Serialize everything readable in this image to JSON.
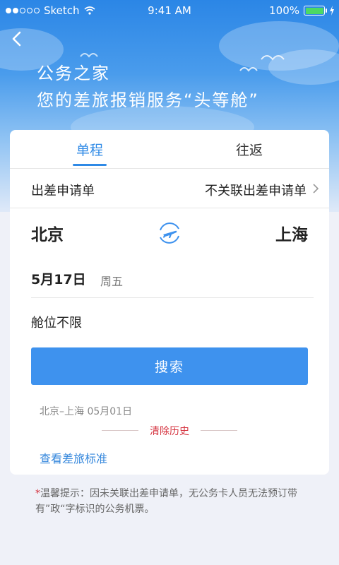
{
  "status_bar": {
    "carrier": "Sketch",
    "time": "9:41 AM",
    "battery": "100%",
    "battery_level": 1.0,
    "battery_color": "#4cd964"
  },
  "header": {
    "back_icon": "chevron-left-icon",
    "title": "公务之家",
    "subtitle": "您的差旅报销服务“头等舱”"
  },
  "tabs": [
    {
      "label": "单程",
      "active": true
    },
    {
      "label": "往返",
      "active": false
    }
  ],
  "application_row": {
    "label": "出差申请单",
    "value": "不关联出差申请单",
    "icon": "chevron-right-icon"
  },
  "route": {
    "from": "北京",
    "to": "上海",
    "swap_icon": "plane-swap-icon"
  },
  "date": {
    "value": "5月17日",
    "weekday": "周五"
  },
  "cabin": "舱位不限",
  "search_button": "搜索",
  "history": {
    "item": "北京–上海 05月01日",
    "clear_label": "清除历史"
  },
  "standard_link": "查看差旅标准",
  "tip": {
    "marker": "*",
    "text": "温馨提示：因未关联出差申请单，无公务卡人员无法预订带有”政“字标识的公务机票。"
  },
  "colors": {
    "accent": "#2f8ae6",
    "button": "#3e92ee",
    "danger": "#d5333f"
  }
}
